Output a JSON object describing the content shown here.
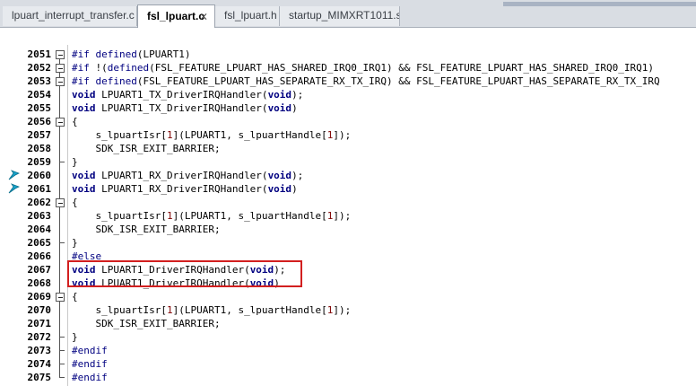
{
  "tabs": [
    {
      "label": "lpuart_interrupt_transfer.c",
      "active": false
    },
    {
      "label": "fsl_lpuart.c",
      "active": true,
      "close": "⨯"
    },
    {
      "label": "fsl_lpuart.h",
      "active": false
    },
    {
      "label": "startup_MIMXRT1011.s",
      "active": false
    }
  ],
  "lines": [
    {
      "n": "2051",
      "text": "#if defined(LPUART1)"
    },
    {
      "n": "2052",
      "text": "#if !(defined(FSL_FEATURE_LPUART_HAS_SHARED_IRQ0_IRQ1) && FSL_FEATURE_LPUART_HAS_SHARED_IRQ0_IRQ1)"
    },
    {
      "n": "2053",
      "text": "#if defined(FSL_FEATURE_LPUART_HAS_SEPARATE_RX_TX_IRQ) && FSL_FEATURE_LPUART_HAS_SEPARATE_RX_TX_IRQ"
    },
    {
      "n": "2054",
      "text": "void LPUART1_TX_DriverIRQHandler(void);"
    },
    {
      "n": "2055",
      "text": "void LPUART1_TX_DriverIRQHandler(void)"
    },
    {
      "n": "2056",
      "text": "{"
    },
    {
      "n": "2057",
      "text": "    s_lpuartIsr[1](LPUART1, s_lpuartHandle[1]);"
    },
    {
      "n": "2058",
      "text": "    SDK_ISR_EXIT_BARRIER;"
    },
    {
      "n": "2059",
      "text": "}"
    },
    {
      "n": "2060",
      "text": "void LPUART1_RX_DriverIRQHandler(void);",
      "bookmark": true
    },
    {
      "n": "2061",
      "text": "void LPUART1_RX_DriverIRQHandler(void)",
      "bookmark": true
    },
    {
      "n": "2062",
      "text": "{"
    },
    {
      "n": "2063",
      "text": "    s_lpuartIsr[1](LPUART1, s_lpuartHandle[1]);"
    },
    {
      "n": "2064",
      "text": "    SDK_ISR_EXIT_BARRIER;"
    },
    {
      "n": "2065",
      "text": "}"
    },
    {
      "n": "2066",
      "text": "#else"
    },
    {
      "n": "2067",
      "text": "void LPUART1_DriverIRQHandler(void);"
    },
    {
      "n": "2068",
      "text": "void LPUART1_DriverIRQHandler(void)"
    },
    {
      "n": "2069",
      "text": "{"
    },
    {
      "n": "2070",
      "text": "    s_lpuartIsr[1](LPUART1, s_lpuartHandle[1]);"
    },
    {
      "n": "2071",
      "text": "    SDK_ISR_EXIT_BARRIER;"
    },
    {
      "n": "2072",
      "text": "}"
    },
    {
      "n": "2073",
      "text": "#endif"
    },
    {
      "n": "2074",
      "text": "#endif"
    },
    {
      "n": "2075",
      "text": "#endif"
    }
  ],
  "colors": {
    "keyword": "#000080",
    "number": "#7f0000",
    "bookmark": "#17a2c9",
    "highlight": "#d21f1f"
  }
}
